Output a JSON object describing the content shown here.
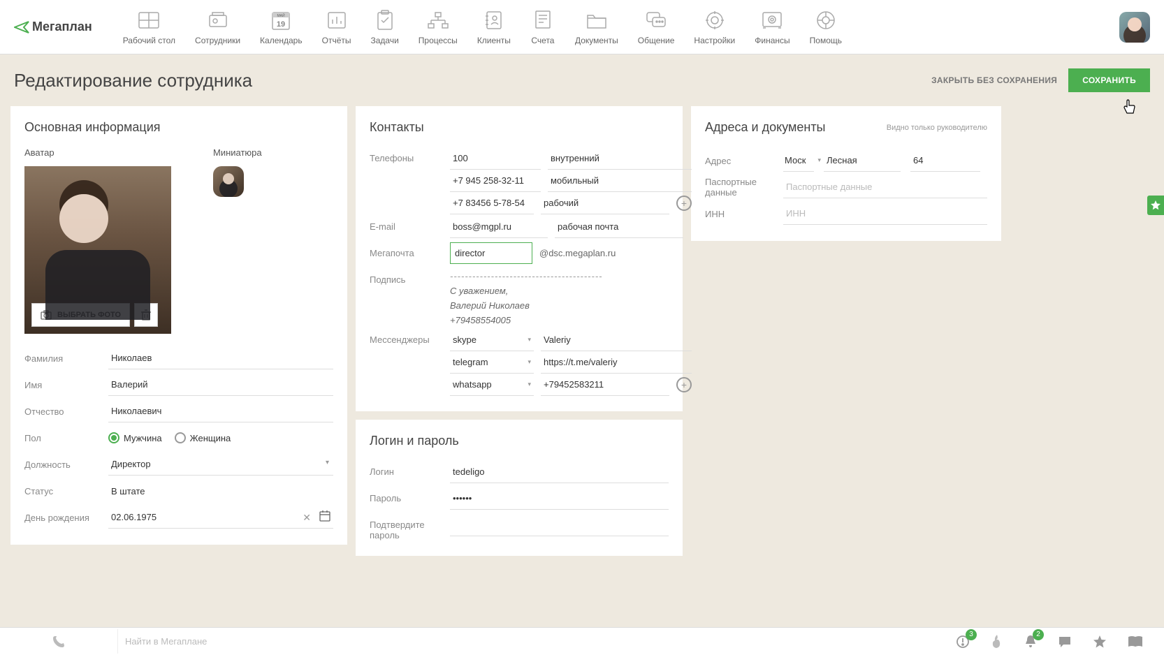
{
  "logo": "Мегаплан",
  "nav": [
    {
      "label": "Рабочий стол"
    },
    {
      "label": "Сотрудники"
    },
    {
      "label": "Календарь",
      "day": "19",
      "month": "МАЙ"
    },
    {
      "label": "Отчёты"
    },
    {
      "label": "Задачи"
    },
    {
      "label": "Процессы"
    },
    {
      "label": "Клиенты"
    },
    {
      "label": "Счета"
    },
    {
      "label": "Документы"
    },
    {
      "label": "Общение"
    },
    {
      "label": "Настройки"
    },
    {
      "label": "Финансы"
    },
    {
      "label": "Помощь"
    }
  ],
  "header": {
    "title": "Редактирование сотрудника",
    "cancel": "ЗАКРЫТЬ БЕЗ СОХРАНЕНИЯ",
    "save": "СОХРАНИТЬ"
  },
  "basic": {
    "title": "Основная информация",
    "avatar_label": "Аватар",
    "thumb_label": "Миниатюра",
    "choose_photo": "ВЫБРАТЬ ФОТО",
    "lastname_label": "Фамилия",
    "lastname": "Николаев",
    "firstname_label": "Имя",
    "firstname": "Валерий",
    "patronymic_label": "Отчество",
    "patronymic": "Николаевич",
    "gender_label": "Пол",
    "gender_m": "Мужчина",
    "gender_f": "Женщина",
    "position_label": "Должность",
    "position": "Директор",
    "status_label": "Статус",
    "status": "В штате",
    "birthday_label": "День рождения",
    "birthday": "02.06.1975"
  },
  "contacts": {
    "title": "Контакты",
    "phones_label": "Телефоны",
    "phones": [
      {
        "num": "100",
        "type": "внутренний"
      },
      {
        "num": "+7 945 258-32-11",
        "type": "мобильный"
      },
      {
        "num": "+7 83456 5-78-54",
        "type": "рабочий"
      }
    ],
    "email_label": "E-mail",
    "email": "boss@mgpl.ru",
    "email_type": "рабочая почта",
    "mega_label": "Мегапочта",
    "mega_user": "director",
    "mega_domain": "@dsc.megaplan.ru",
    "sig_label": "Подпись",
    "sig1": "С уважением,",
    "sig2": "Валерий Николаев",
    "sig3": "+79458554005",
    "msg_label": "Мессенджеры",
    "messengers": [
      {
        "type": "skype",
        "value": "Valeriy"
      },
      {
        "type": "telegram",
        "value": "https://t.me/valeriy"
      },
      {
        "type": "whatsapp",
        "value": "+79452583211"
      }
    ]
  },
  "login": {
    "title": "Логин и пароль",
    "login_label": "Логин",
    "login": "tedeligo",
    "password_label": "Пароль",
    "password": "••••••",
    "confirm_label": "Подтвердите пароль"
  },
  "address": {
    "title": "Адреса и документы",
    "hint": "Видно только руководителю",
    "addr_label": "Адрес",
    "city": "Моск",
    "street": "Лесная",
    "house": "64",
    "passport_label": "Паспортные данные",
    "passport_ph": "Паспортные данные",
    "inn_label": "ИНН",
    "inn_ph": "ИНН"
  },
  "bottombar": {
    "search_ph": "Найти в Мегаплане",
    "badge1": "3",
    "badge2": "2"
  }
}
